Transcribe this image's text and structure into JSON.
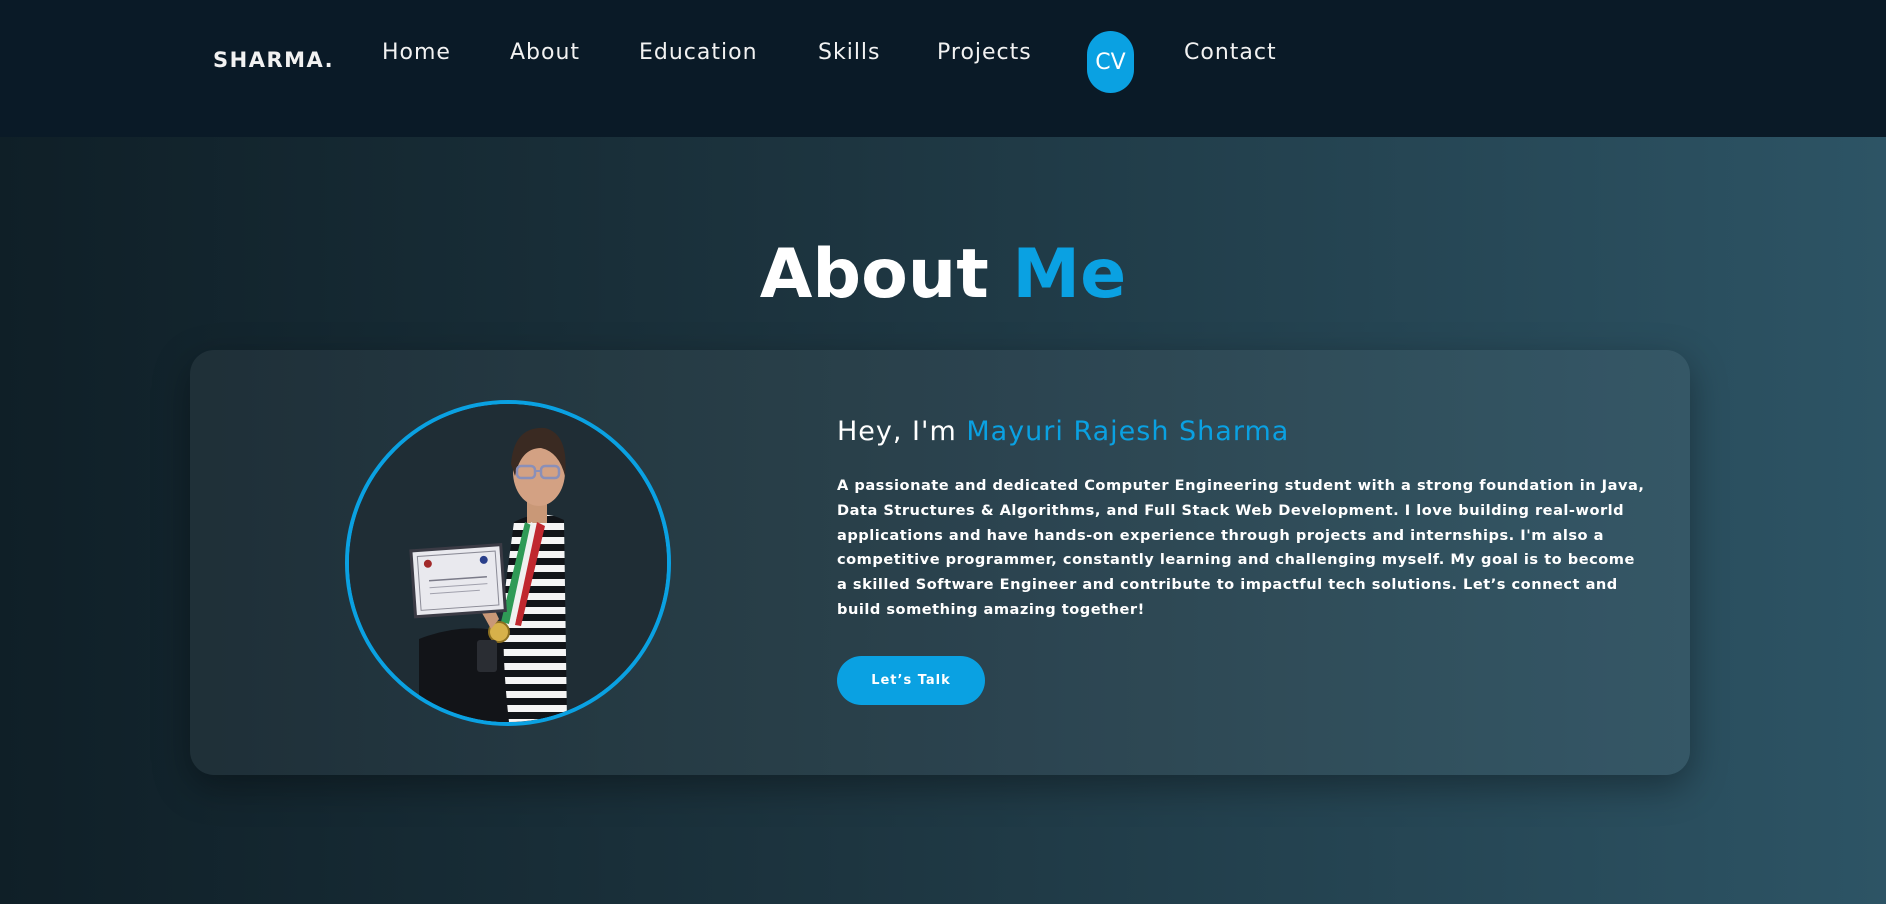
{
  "nav": {
    "brand": "SHARMA.",
    "links": [
      "Home",
      "About",
      "Education",
      "Skills",
      "Projects",
      "CV",
      "Contact"
    ]
  },
  "about": {
    "title_main": "About",
    "title_accent": "Me",
    "greeting_prefix": "Hey, I'm",
    "name": "Mayuri Rajesh Sharma",
    "bio": {
      "part1": "A passionate and dedicated Computer Engineering student with a strong foundation in ",
      "strong1": "Java",
      "sep1": ", ",
      "strong2": "Data Structures & Algorithms",
      "sep2": ", and ",
      "strong3": "Full Stack Web Development",
      "part2": ". I love building real-world applications and have hands-on experience through projects and internships. I'm also a competitive programmer, constantly learning and challenging myself. My goal is to become a skilled Software Engineer and contribute to impactful tech solutions. Let’s connect and build something amazing together!"
    },
    "cta_label": "Let’s Talk"
  },
  "colors": {
    "accent": "#0aa1e2",
    "nav_bg": "#0a1a27",
    "text": "#ffffff"
  },
  "icons": {
    "profile_photo": "profile-photo"
  }
}
